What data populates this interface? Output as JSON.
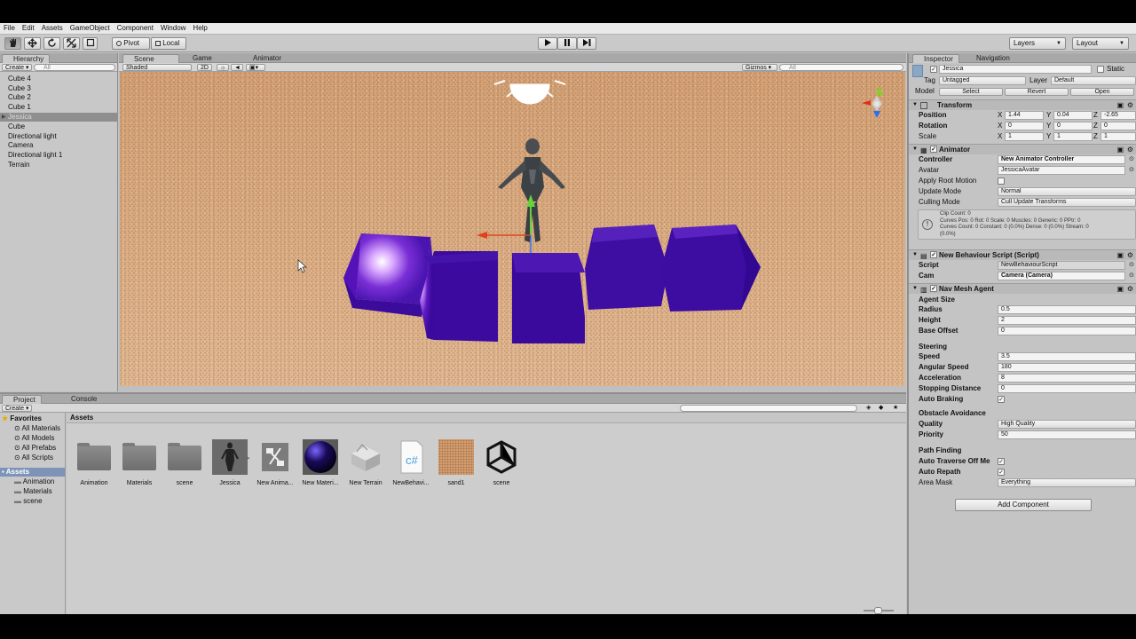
{
  "menu": [
    "File",
    "Edit",
    "Assets",
    "GameObject",
    "Component",
    "Window",
    "Help"
  ],
  "toolbar": {
    "pivot": "Pivot",
    "local": "Local",
    "layers": "Layers",
    "layout": "Layout"
  },
  "hierarchy": {
    "tab": "Hierarchy",
    "create": "Create",
    "search_placeholder": "All",
    "items": [
      "Cube 4",
      "Cube 3",
      "Cube 2",
      "Cube 1",
      "Jessica",
      "Cube",
      "Directional light",
      "Camera",
      "Directional light 1",
      "Terrain"
    ],
    "selected_index": 4
  },
  "scene": {
    "tabs": [
      "Scene",
      "Game",
      "Animator"
    ],
    "shading": "Shaded",
    "mode_2d": "2D",
    "gizmos": "Gizmos",
    "search_placeholder": "All"
  },
  "inspector": {
    "tabs": [
      "Inspector",
      "Navigation"
    ],
    "object_name": "Jessica",
    "static_label": "Static",
    "tag_label": "Tag",
    "tag_value": "Untagged",
    "layer_label": "Layer",
    "layer_value": "Default",
    "model_label": "Model",
    "model_select": "Select",
    "model_revert": "Revert",
    "model_open": "Open",
    "transform": {
      "title": "Transform",
      "position_label": "Position",
      "rotation_label": "Rotation",
      "scale_label": "Scale",
      "position": [
        "1.44",
        "0.04",
        "-2.65"
      ],
      "rotation": [
        "0",
        "0",
        "0"
      ],
      "scale": [
        "1",
        "1",
        "1"
      ],
      "axes": [
        "X",
        "Y",
        "Z"
      ]
    },
    "animator": {
      "title": "Animator",
      "controller_label": "Controller",
      "controller_value": "New Animator Controller",
      "avatar_label": "Avatar",
      "avatar_value": "JessicaAvatar",
      "root_motion_label": "Apply Root Motion",
      "update_mode_label": "Update Mode",
      "update_mode_value": "Normal",
      "culling_label": "Culling Mode",
      "culling_value": "Cull Update Transforms",
      "info_line1": "Clip Count: 0",
      "info_line2": "Curves Pos: 0 Rot: 0 Scale: 0 Muscles: 0 Generic: 0 PPtr: 0",
      "info_line3": "Curves Count: 0 Constant: 0 (0.0%) Dense: 0 (0.0%) Stream: 0",
      "info_line4": "(0.0%)"
    },
    "script": {
      "title": "New Behaviour Script (Script)",
      "script_label": "Script",
      "script_value": "NewBehaviourScript",
      "cam_label": "Cam",
      "cam_value": "Camera (Camera)"
    },
    "nav": {
      "title": "Nav Mesh Agent",
      "agent_size": "Agent Size",
      "radius_label": "Radius",
      "radius": "0.5",
      "height_label": "Height",
      "height": "2",
      "base_offset_label": "Base Offset",
      "base_offset": "0",
      "steering": "Steering",
      "speed_label": "Speed",
      "speed": "3.5",
      "angular_label": "Angular Speed",
      "angular": "180",
      "accel_label": "Acceleration",
      "accel": "8",
      "stopping_label": "Stopping Distance",
      "stopping": "0",
      "braking_label": "Auto Braking",
      "obstacle": "Obstacle Avoidance",
      "quality_label": "Quality",
      "quality": "High Quality",
      "priority_label": "Priority",
      "priority": "50",
      "path_finding": "Path Finding",
      "traverse_label": "Auto Traverse Off Me",
      "repath_label": "Auto Repath",
      "area_label": "Area Mask",
      "area": "Everything"
    },
    "add_component": "Add Component"
  },
  "project": {
    "tabs": [
      "Project",
      "Console"
    ],
    "create": "Create",
    "favorites": "Favorites",
    "favorite_items": [
      "All Materials",
      "All Models",
      "All Prefabs",
      "All Scripts"
    ],
    "assets_root": "Assets",
    "asset_folders": [
      "Animation",
      "Materials",
      "scene"
    ],
    "breadcrumb": "Assets",
    "assets": [
      "Animation",
      "Materials",
      "scene",
      "Jessica",
      "New Anima...",
      "New Materi...",
      "New Terrain",
      "NewBehavi...",
      "sand1",
      "scene"
    ]
  },
  "colors": {
    "cube_purple": "#3b0aa0",
    "sand": "#d7a678",
    "unity_gray": "#c2c2c2"
  }
}
